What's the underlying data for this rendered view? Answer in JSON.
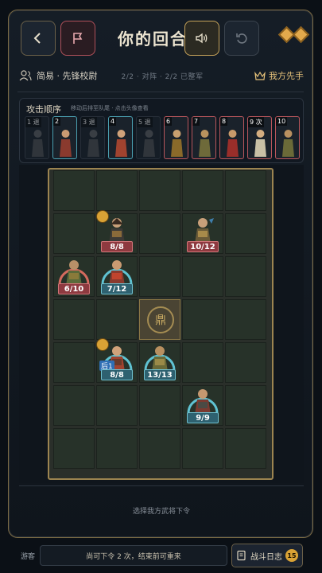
{
  "header": {
    "title": "你的回合",
    "back_icon": "chevron-left-icon",
    "flag_icon": "flag-icon",
    "sound_icon": "speaker-icon",
    "undo_icon": "undo-icon",
    "accent_color": "#c6a35a"
  },
  "info": {
    "mode": "简易 · 先锋校尉",
    "stats": "2/2 · 对阵 · 2/2 已整军",
    "first_move": "我方先手"
  },
  "attack_order": {
    "title": "攻击顺序",
    "hint": "移动后排至队尾 · 点击头像查看",
    "cards": [
      {
        "label": "1 退",
        "state": "retreat"
      },
      {
        "label": "2",
        "state": "ally"
      },
      {
        "label": "3 退",
        "state": "retreat"
      },
      {
        "label": "4",
        "state": "ally"
      },
      {
        "label": "5 退",
        "state": "retreat"
      },
      {
        "label": "6",
        "state": "enemy"
      },
      {
        "label": "7",
        "state": "enemy"
      },
      {
        "label": "8",
        "state": "enemy"
      },
      {
        "label": "9 次",
        "state": "enemy"
      },
      {
        "label": "10",
        "state": "enemy"
      }
    ]
  },
  "board": {
    "center_glyph": "鼎",
    "units": [
      {
        "hp": "8/8",
        "side": "enemy"
      },
      {
        "hp": "10/12",
        "side": "enemy"
      },
      {
        "hp": "6/10",
        "side": "enemy"
      },
      {
        "hp": "7/12",
        "side": "ally"
      },
      {
        "hp": "8/8",
        "side": "ally",
        "tag": "后1"
      },
      {
        "hp": "13/13",
        "side": "ally"
      },
      {
        "hp": "9/9",
        "side": "ally"
      }
    ]
  },
  "prompt": "选择我方武将下令",
  "footer": {
    "guest": "游客",
    "command_status": "尚可下令 2 次，结束前可重来",
    "log_label": "战斗日志",
    "log_count": "15"
  }
}
